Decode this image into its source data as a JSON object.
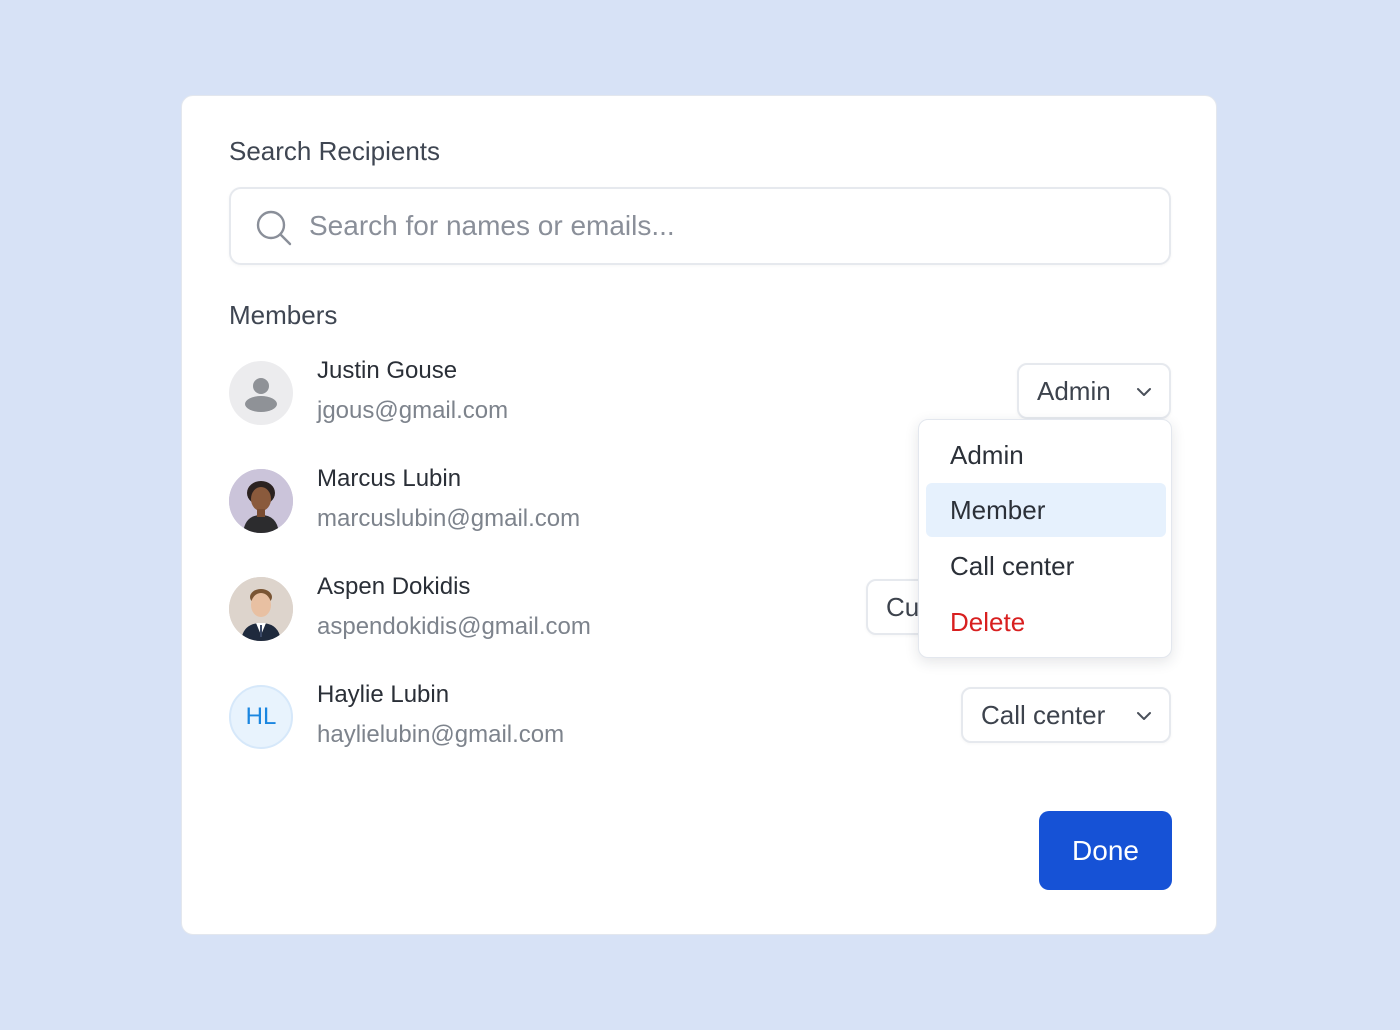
{
  "search": {
    "label": "Search Recipients",
    "placeholder": "Search for names or emails...",
    "value": ""
  },
  "members_section": {
    "label": "Members",
    "items": [
      {
        "name": "Justin Gouse",
        "email": "jgous@gmail.com",
        "avatar": "placeholder-person-icon",
        "role": "Admin"
      },
      {
        "name": "Marcus Lubin",
        "email": "marcuslubin@gmail.com",
        "avatar": "photo",
        "role": ""
      },
      {
        "name": "Aspen Dokidis",
        "email": "aspendokidis@gmail.com",
        "avatar": "photo",
        "role": "Cu"
      },
      {
        "name": "Haylie Lubin",
        "email": "haylielubin@gmail.com",
        "avatar_initials": "HL",
        "role": "Call center"
      }
    ]
  },
  "role_dropdown": {
    "options": [
      {
        "label": "Admin"
      },
      {
        "label": "Member",
        "highlighted": true
      },
      {
        "label": "Call center"
      },
      {
        "label": "Delete",
        "danger": true
      }
    ]
  },
  "actions": {
    "done_label": "Done"
  },
  "colors": {
    "page_background": "#d7e2f6",
    "primary": "#1652d6",
    "danger": "#d81f1f",
    "highlight": "#e6f1fd",
    "initials_avatar_text": "#1a86e0",
    "initials_avatar_bg": "#e8f3fd"
  }
}
